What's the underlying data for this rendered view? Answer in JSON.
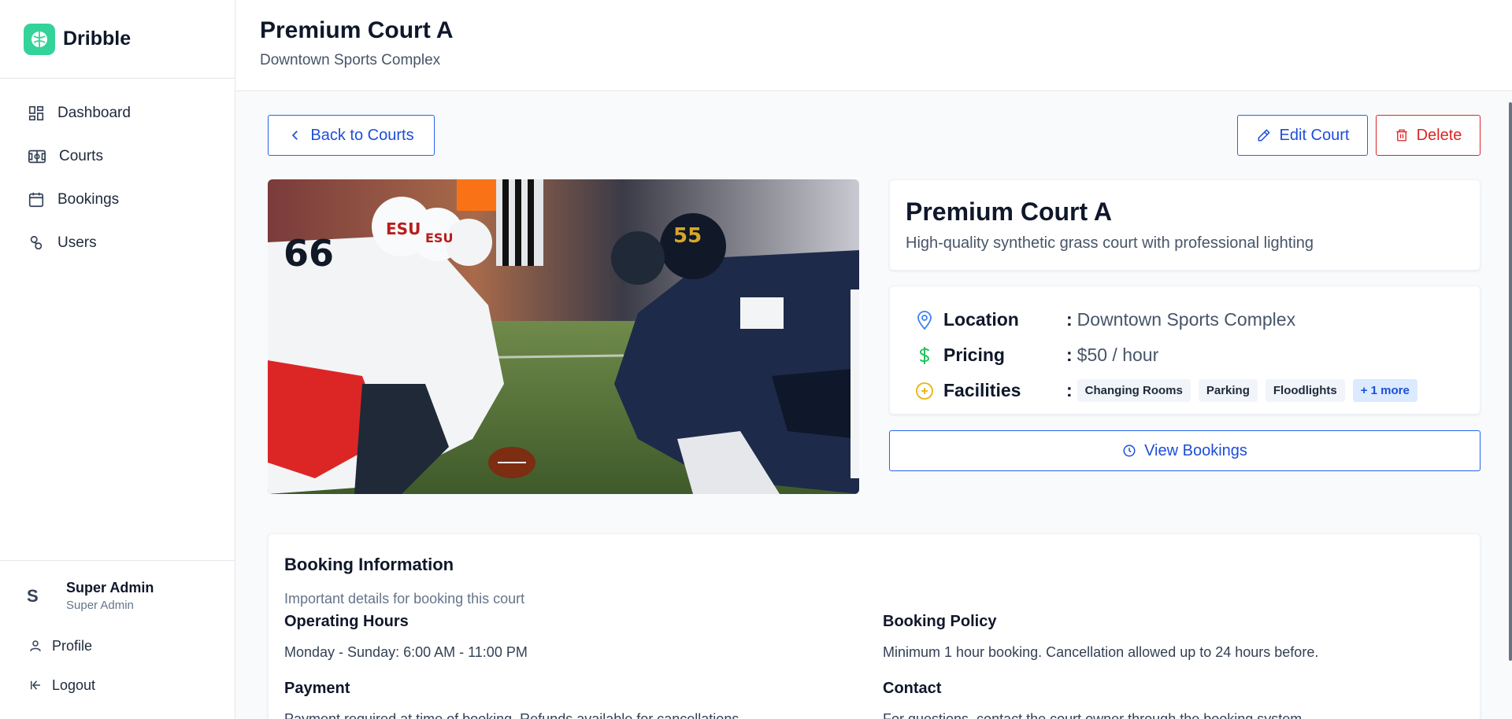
{
  "brand": {
    "name": "Dribble",
    "color": "#34d399"
  },
  "sidebar": {
    "items": [
      {
        "label": "Dashboard",
        "icon": "dashboard-icon"
      },
      {
        "label": "Courts",
        "icon": "court-icon"
      },
      {
        "label": "Bookings",
        "icon": "calendar-icon"
      },
      {
        "label": "Users",
        "icon": "users-icon"
      }
    ],
    "user": {
      "initial": "S",
      "name": "Super Admin",
      "role": "Super Admin"
    },
    "profile_label": "Profile",
    "logout_label": "Logout"
  },
  "header": {
    "title": "Premium Court A",
    "subtitle": "Downtown Sports Complex"
  },
  "toolbar": {
    "back_label": "Back to Courts",
    "edit_label": "Edit Court",
    "delete_label": "Delete"
  },
  "court": {
    "name": "Premium Court A",
    "description": "High-quality synthetic grass court with professional lighting",
    "location_label": "Location",
    "location": "Downtown Sports Complex",
    "pricing_label": "Pricing",
    "pricing": "$50 / hour",
    "facilities_label": "Facilities",
    "facilities": [
      "Changing Rooms",
      "Parking",
      "Floodlights"
    ],
    "facilities_more": "+ 1 more",
    "view_bookings_label": "View Bookings"
  },
  "booking_info": {
    "title": "Booking Information",
    "subtitle": "Important details for booking this court",
    "operating_hours_label": "Operating Hours",
    "operating_hours": "Monday - Sunday: 6:00 AM - 11:00 PM",
    "policy_label": "Booking Policy",
    "policy": "Minimum 1 hour booking. Cancellation allowed up to 24 hours before.",
    "payment_label": "Payment",
    "payment": "Payment required at time of booking. Refunds available for cancellations.",
    "contact_label": "Contact",
    "contact": "For questions, contact the court owner through the booking system."
  },
  "colors": {
    "primary": "#2563eb",
    "danger": "#dc2626",
    "location_icon": "#3b82f6",
    "pricing_icon": "#22c55e",
    "facilities_icon": "#eab308"
  }
}
